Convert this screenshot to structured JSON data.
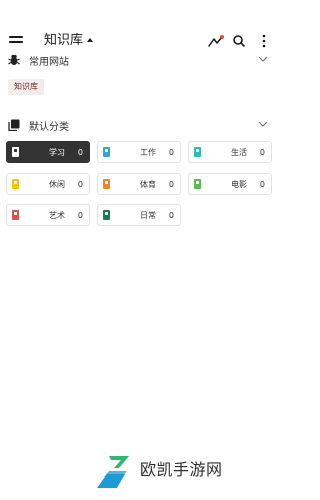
{
  "header": {
    "title": "知识库",
    "icons": [
      "menu-icon",
      "chart-trend-icon",
      "search-icon",
      "more-vertical-icon"
    ]
  },
  "sections": {
    "sites": {
      "label": "常用网站",
      "icon": "bug-icon",
      "chips": [
        "知识库"
      ]
    },
    "categories": {
      "label": "默认分类",
      "icon": "notebook-icon",
      "items": [
        {
          "name": "学习",
          "count": "0",
          "color": "#ffffff",
          "active": true
        },
        {
          "name": "工作",
          "count": "0",
          "color": "#3aa3c8",
          "active": false
        },
        {
          "name": "生活",
          "count": "0",
          "color": "#2bbcb4",
          "active": false
        },
        {
          "name": "休闲",
          "count": "0",
          "color": "#f1c40f",
          "active": false
        },
        {
          "name": "体育",
          "count": "0",
          "color": "#e8872d",
          "active": false
        },
        {
          "name": "电影",
          "count": "0",
          "color": "#5cb85c",
          "active": false
        },
        {
          "name": "艺术",
          "count": "0",
          "color": "#d9534f",
          "active": false
        },
        {
          "name": "日常",
          "count": "0",
          "color": "#1f7a4d",
          "active": false
        }
      ]
    }
  },
  "watermark": {
    "text": "欧凯手游网"
  },
  "colors": {
    "accent": "#333333",
    "chip_bg": "#f3ecec",
    "chip_text": "#6a2b2b",
    "logo_green": "#2eb872",
    "logo_blue": "#1e9ad6"
  }
}
